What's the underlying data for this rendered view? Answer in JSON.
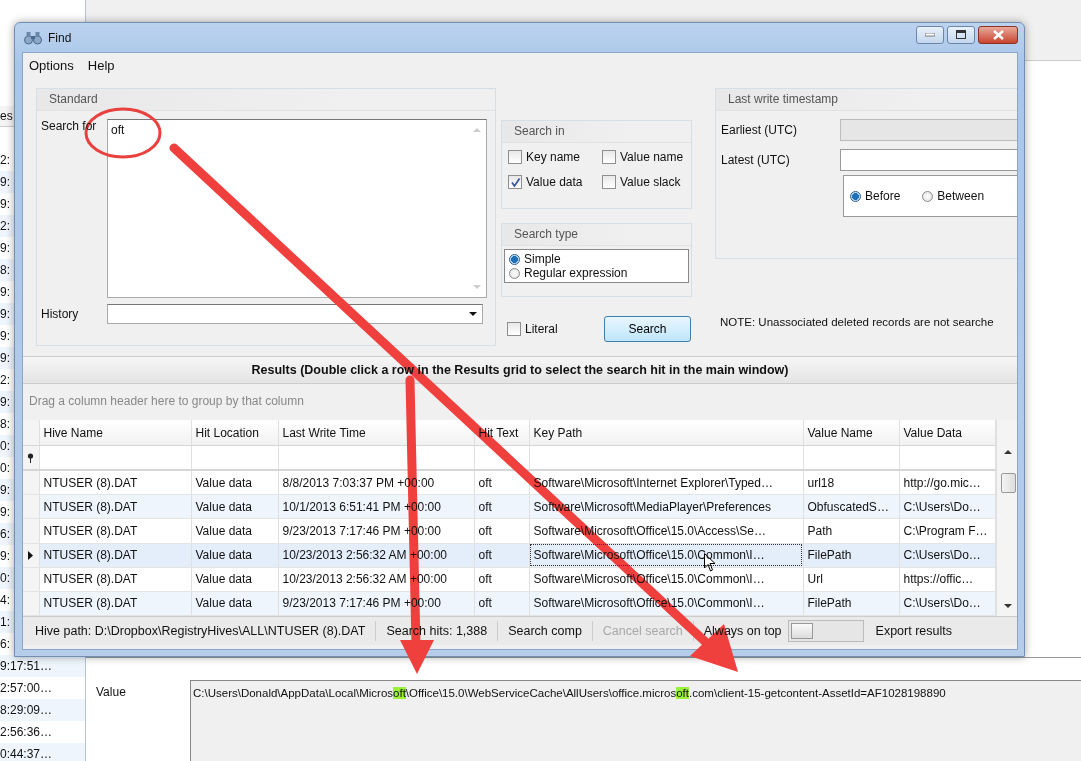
{
  "background": {
    "column_header": "es",
    "time_cells": [
      "2:",
      "9:",
      "9:",
      "2:",
      "9:",
      "8:",
      "9:",
      "9:",
      "9:",
      "9:",
      "2:",
      "9:",
      "8:",
      "0:",
      "0:",
      "9:",
      "9:",
      "6:",
      "9:",
      "0:",
      "4:",
      "1:",
      "6:",
      "9:17:51…",
      "2:57:00…",
      "8:29:09…",
      "2:56:36…",
      "0:44:37…"
    ],
    "value_label": "Value",
    "value_segments": [
      {
        "text": "C:\\Users\\Donald\\AppData\\Local\\Micros",
        "highlighted": false
      },
      {
        "text": "oft",
        "highlighted": true
      },
      {
        "text": "\\Office\\15.0\\WebServiceCache\\AllUsers\\office.micros",
        "highlighted": false
      },
      {
        "text": "oft",
        "highlighted": true
      },
      {
        "text": ".com\\client-15-getcontent-AssetId=AF1028198890",
        "highlighted": false
      }
    ]
  },
  "window": {
    "title": "Find"
  },
  "menu": [
    "Options",
    "Help"
  ],
  "standard": {
    "title": "Standard",
    "search_label": "Search for",
    "search_value": "oft",
    "history_label": "History"
  },
  "search_in": {
    "title": "Search in",
    "options": [
      {
        "label": "Key name",
        "checked": false
      },
      {
        "label": "Value name",
        "checked": false
      },
      {
        "label": "Value data",
        "checked": true
      },
      {
        "label": "Value slack",
        "checked": false
      }
    ]
  },
  "search_type": {
    "title": "Search type",
    "options": [
      {
        "label": "Simple",
        "selected": true
      },
      {
        "label": "Regular expression",
        "selected": false
      }
    ]
  },
  "literal": {
    "label": "Literal",
    "checked": false
  },
  "search_button": "Search",
  "timestamp": {
    "title": "Last write timestamp",
    "earliest_label": "Earliest (UTC)",
    "earliest_disabled": true,
    "latest_label": "Latest (UTC)",
    "modes": [
      {
        "label": "Before",
        "selected": true
      },
      {
        "label": "Between",
        "selected": false
      }
    ]
  },
  "note": "NOTE: Unassociated deleted records are not searche",
  "results": {
    "title": "Results (Double click a row in the Results grid to select the search hit in the main window)",
    "group_hint": "Drag a column header here to group by that column",
    "columns": [
      "Hive Name",
      "Hit Location",
      "Last Write Time",
      "Hit Text",
      "Key Path",
      "Value Name",
      "Value Data"
    ],
    "rows": [
      {
        "selected": false,
        "cells": [
          "NTUSER (8).DAT",
          "Value data",
          "8/8/2013 7:03:37 PM +00:00",
          "oft",
          "Software\\Microsoft\\Internet Explorer\\Typed…",
          "url18",
          "http://go.mic…"
        ]
      },
      {
        "selected": false,
        "cells": [
          "NTUSER (8).DAT",
          "Value data",
          "10/1/2013 6:51:41 PM +00:00",
          "oft",
          "Software\\Microsoft\\MediaPlayer\\Preferences",
          "ObfuscatedS…",
          "C:\\Users\\Do…"
        ]
      },
      {
        "selected": false,
        "cells": [
          "NTUSER (8).DAT",
          "Value data",
          "9/23/2013 7:17:46 PM +00:00",
          "oft",
          "Software\\Microsoft\\Office\\15.0\\Access\\Se…",
          "Path",
          "C:\\Program F…"
        ]
      },
      {
        "selected": true,
        "cells": [
          "NTUSER (8).DAT",
          "Value data",
          "10/23/2013 2:56:32 AM +00:00",
          "oft",
          "Software\\Microsoft\\Office\\15.0\\Common\\I…",
          "FilePath",
          "C:\\Users\\Do…"
        ]
      },
      {
        "selected": false,
        "cells": [
          "NTUSER (8).DAT",
          "Value data",
          "10/23/2013 2:56:32 AM +00:00",
          "oft",
          "Software\\Microsoft\\Office\\15.0\\Common\\I…",
          "Url",
          "https://offic…"
        ]
      },
      {
        "selected": false,
        "cells": [
          "NTUSER (8).DAT",
          "Value data",
          "9/23/2013 7:17:46 PM +00:00",
          "oft",
          "Software\\Microsoft\\Office\\15.0\\Common\\I…",
          "FilePath",
          "C:\\Users\\Do…"
        ]
      }
    ]
  },
  "status_bar": {
    "hive_path": "Hive path: D:\\Dropbox\\RegistryHives\\ALL\\NTUSER (8).DAT",
    "search_hits": "Search hits: 1,388",
    "search_status": "Search comp",
    "cancel": {
      "label": "Cancel search",
      "disabled": true
    },
    "always_on_top": {
      "label": "Always on top",
      "on": false
    },
    "export": "Export results"
  }
}
